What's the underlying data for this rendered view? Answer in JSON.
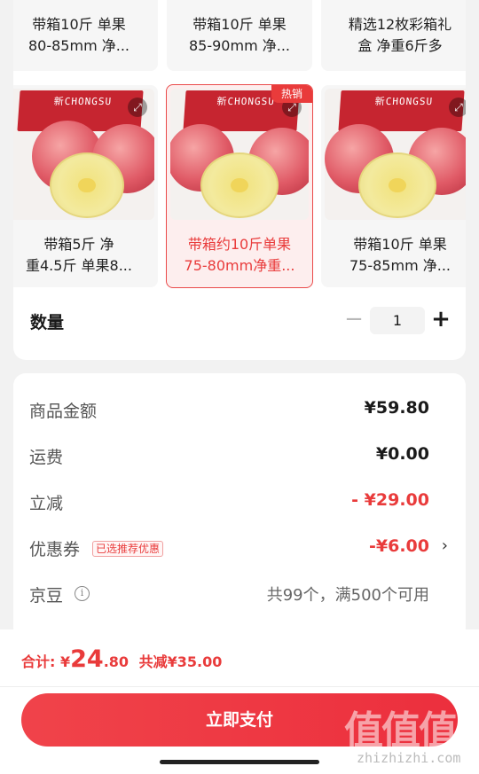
{
  "sku": {
    "row1": [
      {
        "name_line1": "带箱10斤 单果",
        "name_line2": "80-85mm 净..."
      },
      {
        "name_line1": "带箱10斤 单果",
        "name_line2": "85-90mm 净..."
      },
      {
        "name_line1": "精选12枚彩箱礼",
        "name_line2": "盒 净重6斤多"
      }
    ],
    "row2": [
      {
        "name_line1": "带箱5斤 净",
        "name_line2": "重4.5斤 单果8...",
        "box_text": "新CHONGSU"
      },
      {
        "name_line1": "带箱约10斤单果",
        "name_line2": "75-80mm净重...",
        "box_text": "新CHONGSU",
        "badge": "热销",
        "selected": true
      },
      {
        "name_line1": "带箱10斤 单果",
        "name_line2": "75-85mm 净...",
        "box_text": "新CHONGSU"
      }
    ],
    "expand_glyph": "⤢",
    "quantity": {
      "label": "数量",
      "minus": "−",
      "value": "1",
      "plus": "+"
    }
  },
  "summary": {
    "goods_amount": {
      "label": "商品金额",
      "value": "¥59.80"
    },
    "shipping": {
      "label": "运费",
      "value": "¥0.00"
    },
    "instant_discount": {
      "label": "立减",
      "value": "- ¥29.00"
    },
    "coupon": {
      "label": "优惠券",
      "tag": "已选推荐优惠",
      "value": "-¥6.00",
      "chevron": "›"
    },
    "jingdou": {
      "label": "京豆",
      "info": "i",
      "note": "共99个，满500个可用"
    }
  },
  "bottom": {
    "total_label": "合计:",
    "currency": "¥",
    "price_int": "24",
    "price_dec": ".80",
    "saved": "共减¥35.00",
    "pay_button": "立即支付"
  },
  "watermark": {
    "big": "值值值",
    "small": "zhizhizhi.com"
  },
  "colors": {
    "accent": "#e93b3b",
    "background": "#f2f2f2",
    "card": "#ffffff"
  }
}
